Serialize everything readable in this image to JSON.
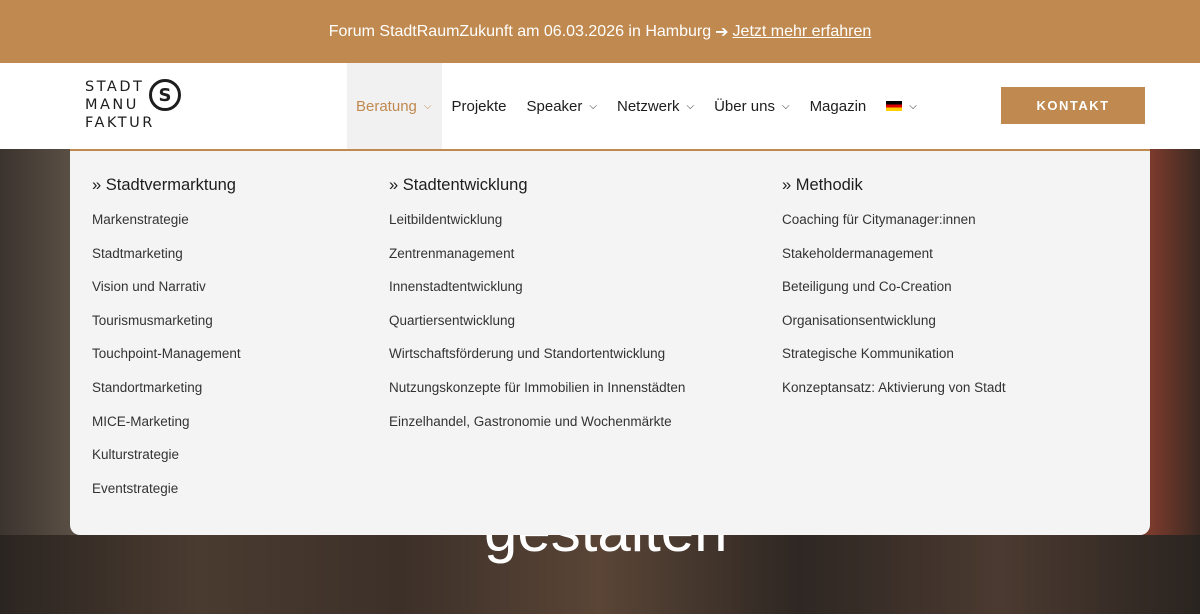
{
  "banner": {
    "text": "Forum StadtRaumZukunft am 06.03.2026 in Hamburg",
    "arrow": "➔",
    "link": "Jetzt mehr erfahren"
  },
  "logo": {
    "lines": [
      "STADT",
      "MANU",
      "FAKTUR"
    ],
    "mark": "S"
  },
  "nav": {
    "items": [
      {
        "label": "Beratung",
        "dropdown": true,
        "active": true
      },
      {
        "label": "Projekte",
        "dropdown": false
      },
      {
        "label": "Speaker",
        "dropdown": true
      },
      {
        "label": "Netzwerk",
        "dropdown": true
      },
      {
        "label": "Über uns",
        "dropdown": true
      },
      {
        "label": "Magazin",
        "dropdown": false
      }
    ],
    "language_icon": "german-flag-icon",
    "cta": "KONTAKT"
  },
  "mega_menu": {
    "columns": [
      {
        "heading": "» Stadtvermarktung",
        "items": [
          "Markenstrategie",
          "Stadtmarketing",
          "Vision und Narrativ",
          "Tourismusmarketing",
          "Touchpoint-Management",
          "Standortmarketing",
          "MICE-Marketing",
          "Kulturstrategie",
          "Eventstrategie"
        ]
      },
      {
        "heading": "» Stadtentwicklung",
        "items": [
          "Leitbildentwicklung",
          "Zentrenmanagement",
          "Innenstadtentwicklung",
          "Quartiersentwicklung",
          "Wirtschaftsförderung und Standortentwicklung",
          "Nutzungskonzepte für Immobilien in Innenstädten",
          "Einzelhandel, Gastronomie und Wochenmärkte"
        ]
      },
      {
        "heading": "» Methodik",
        "items": [
          "Coaching für Citymanager:innen",
          "Stakeholdermanagement",
          "Beteiligung und Co-Creation",
          "Organisationsentwicklung",
          "Strategische Kommunikation",
          "Konzeptansatz: Aktivierung von Stadt"
        ]
      }
    ]
  },
  "hero": {
    "partial_headline": "gestalten"
  },
  "colors": {
    "accent": "#c0894f",
    "menu_bg": "#f4f4f4"
  }
}
